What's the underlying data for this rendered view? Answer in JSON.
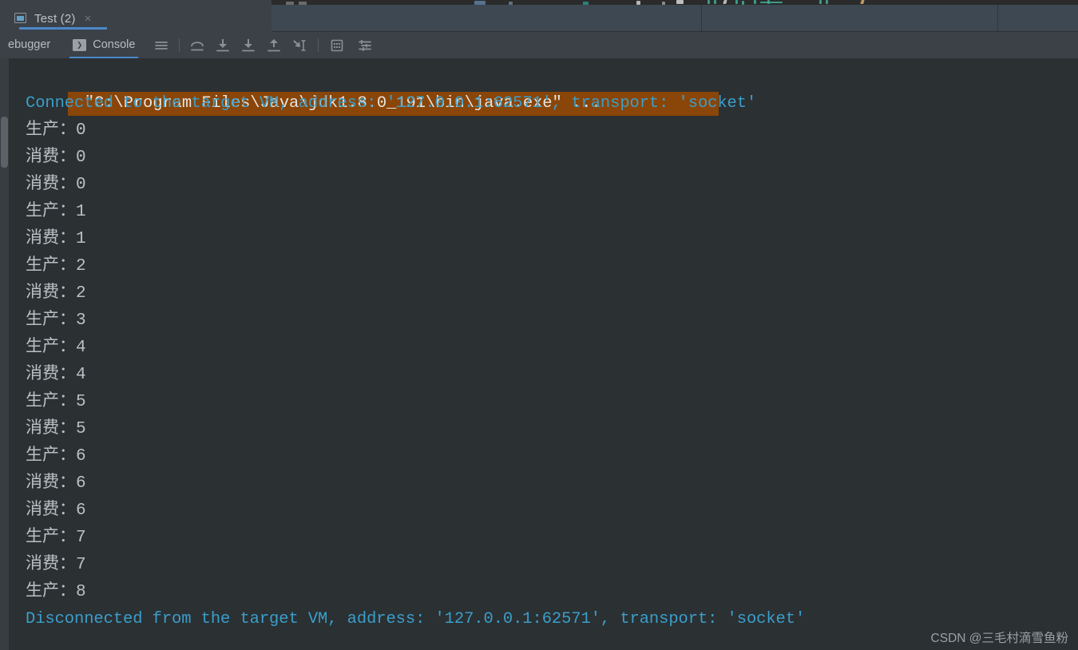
{
  "window": {
    "bg_color": "#2b3033",
    "panel_color": "#3c4148",
    "band_color": "#3d4852",
    "accent_color": "#4a88c7"
  },
  "tab": {
    "label": "Test (2)",
    "close_label": "×",
    "icon": "run-configuration-icon"
  },
  "toolbar": {
    "debugger_label": "ebugger",
    "console_label": "Console",
    "console_badge": "❯",
    "icons": [
      {
        "name": "menu-icon",
        "glyph": "hamburger"
      },
      {
        "name": "step-over-icon",
        "glyph": "step-over"
      },
      {
        "name": "step-into-icon",
        "glyph": "step-into"
      },
      {
        "name": "force-step-into-icon",
        "glyph": "force-step-into"
      },
      {
        "name": "step-out-icon",
        "glyph": "step-out"
      },
      {
        "name": "run-to-cursor-icon",
        "glyph": "run-to-cursor"
      },
      {
        "name": "evaluate-expression-icon",
        "glyph": "evaluate"
      },
      {
        "name": "settings-icon",
        "glyph": "settings"
      }
    ]
  },
  "console": {
    "command_line": "\"C:\\Program Files\\Java\\jdk1.8.0_191\\bin\\java.exe\" ...",
    "command_bg": "#8a4508",
    "connected_line": "Connected to the target VM, address: '127.0.0.1:62571', transport: 'socket'",
    "disconnected_line": "Disconnected from the target VM, address: '127.0.0.1:62571', transport: 'socket'",
    "system_color": "#3a9ec9",
    "output_color": "#bcc0c4",
    "output_lines": [
      "生产：0",
      "消费：0",
      "消费：0",
      "生产：1",
      "消费：1",
      "生产：2",
      "消费：2",
      "生产：3",
      "生产：4",
      "消费：4",
      "生产：5",
      "消费：5",
      "生产：6",
      "消费：6",
      "消费：6",
      "生产：7",
      "消费：7",
      "生产：8"
    ]
  },
  "watermark": {
    "text": "CSDN @三毛村滴雪鱼粉"
  }
}
